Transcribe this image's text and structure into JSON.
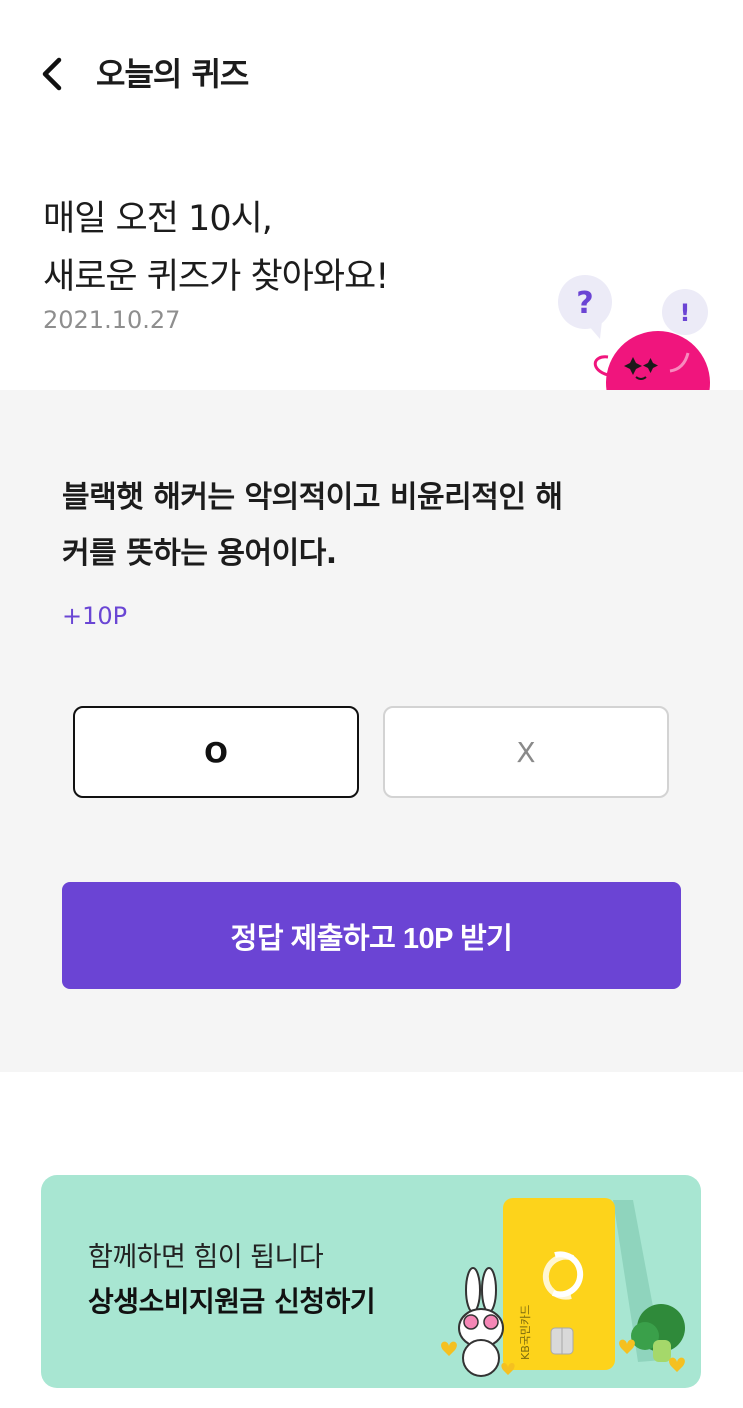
{
  "header": {
    "back_icon": "chevron-left-icon",
    "title": "오늘의 퀴즈"
  },
  "intro": {
    "headline_line1": "매일 오전 10시,",
    "headline_line2": "새로운 퀴즈가 찾아와요!",
    "date": "2021.10.27",
    "mascot_question_mark": "?",
    "mascot_exclamation_mark": "!"
  },
  "quiz": {
    "question_line1": "블랙햇 해커는 악의적이고 비윤리적인 해",
    "question_line2": "커를 뜻하는 용어이다.",
    "points": "+10P",
    "choice_o": "O",
    "choice_x": "X",
    "selected": "O",
    "submit_label": "정답 제출하고 10P 받기"
  },
  "banner": {
    "subtitle": "함께하면 힘이 됩니다",
    "title": "상생소비지원금 신청하기",
    "card_text": "KB국민카드"
  },
  "colors": {
    "accent": "#6b44d4",
    "banner_bg": "#a8e6d2",
    "panel_bg": "#f5f5f5",
    "mascot_pink": "#f0157d",
    "card_yellow": "#fdd31b"
  }
}
